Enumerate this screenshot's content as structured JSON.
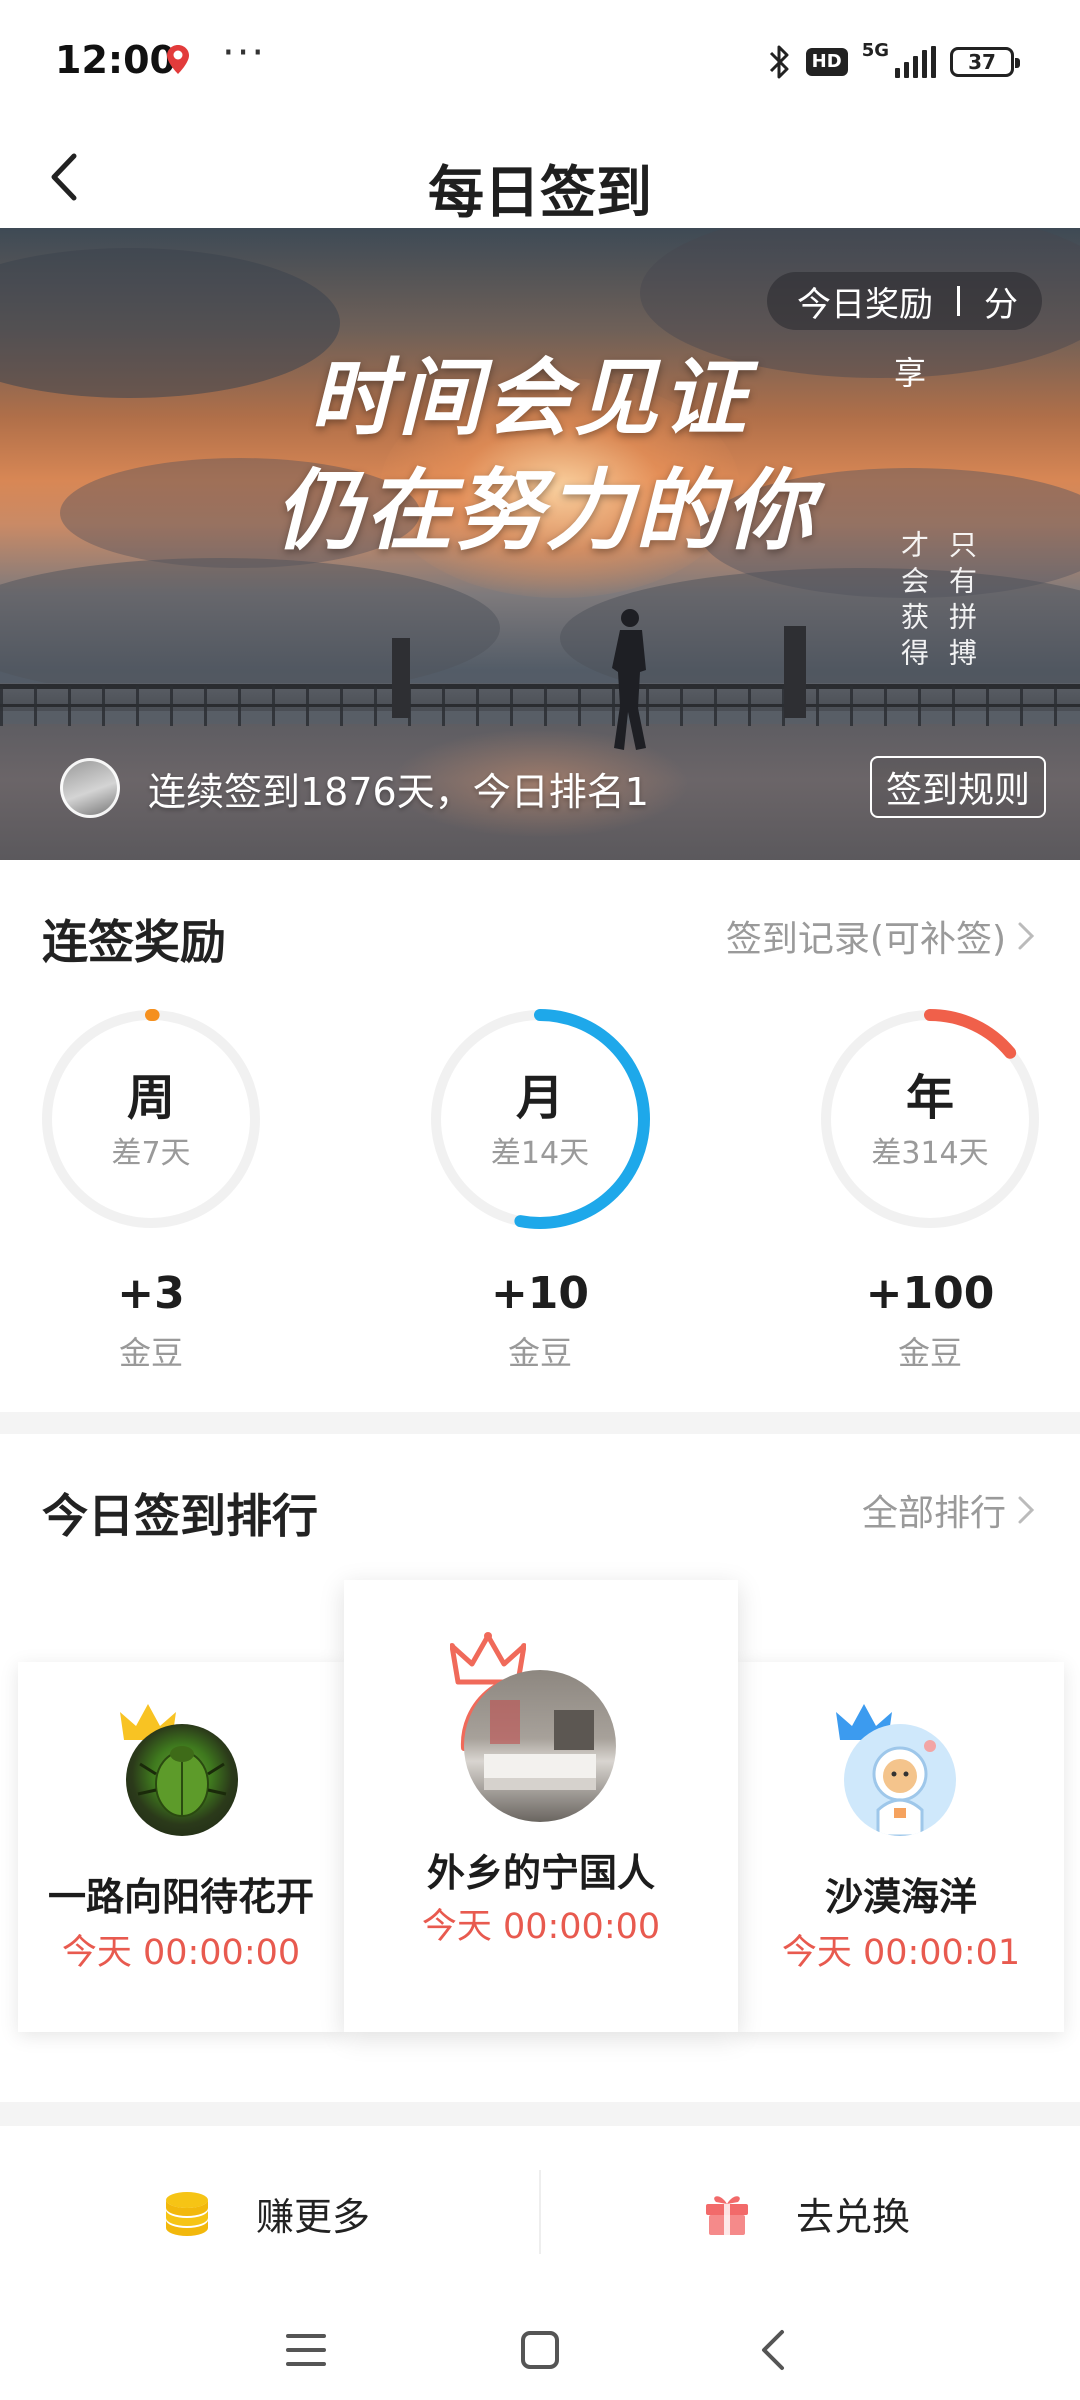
{
  "status_bar": {
    "time": "12:00",
    "more": "···",
    "network": "5G",
    "hd": "HD",
    "battery": "37"
  },
  "header": {
    "title": "每日签到"
  },
  "banner": {
    "headline_line1": "时间会见证",
    "headline_line2": "仍在努力的你",
    "vertical_col1": "只有拼搏",
    "vertical_col2": "才会获得",
    "share_left": "今日奖励",
    "share_right": "分",
    "share_tail": "享",
    "streak_text": "连续签到1876天，今日排名1",
    "rules_button": "签到规则"
  },
  "streak_rewards": {
    "title": "连签奖励",
    "link": "签到记录(可补签)",
    "items": [
      {
        "label": "周",
        "remaining": "差7天",
        "progress": 0.0,
        "color": "#f5901e",
        "reward": "+3",
        "unit": "金豆"
      },
      {
        "label": "月",
        "remaining": "差14天",
        "progress": 0.53,
        "color": "#1ea8ea",
        "reward": "+10",
        "unit": "金豆"
      },
      {
        "label": "年",
        "remaining": "差314天",
        "progress": 0.14,
        "color": "#f0604a",
        "reward": "+100",
        "unit": "金豆"
      }
    ]
  },
  "ranking": {
    "title": "今日签到排行",
    "link": "全部排行",
    "entries": [
      {
        "rank": 1,
        "name": "外乡的宁国人",
        "time": "今天 00:00:00",
        "crown_color": "#f06a5a"
      },
      {
        "rank": 2,
        "name": "一路向阳待花开",
        "time": "今天 00:00:00",
        "crown_color": "#f8c323"
      },
      {
        "rank": 3,
        "name": "沙漠海洋",
        "time": "今天 00:00:01",
        "crown_color": "#3c9bef"
      }
    ]
  },
  "bottom_actions": {
    "earn_more": "赚更多",
    "redeem": "去兑换"
  },
  "colors": {
    "accent_red": "#e85a4f",
    "coin_yellow": "#f6c415",
    "gift_red": "#f26a6a"
  }
}
